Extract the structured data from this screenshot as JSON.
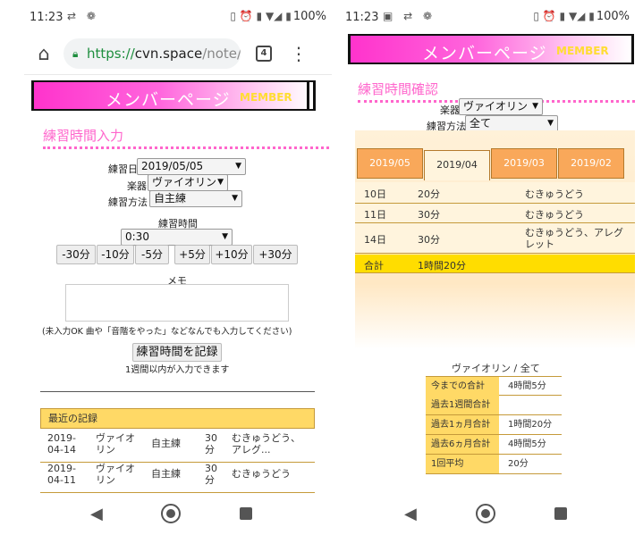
{
  "status": {
    "left": {
      "time": "11:23",
      "battery": "100%"
    },
    "right": {
      "time": "11:23",
      "battery": "100%"
    }
  },
  "browser": {
    "url_scheme": "https://",
    "url_host": "cvn.space",
    "url_path": "/note/",
    "tab_count": "4"
  },
  "banner": {
    "title": "メンバーページ",
    "subtitle": "MEMBER"
  },
  "input_page": {
    "section_title": "練習時間入力",
    "date_label": "練習日",
    "date_value": "2019/05/05",
    "instrument_label": "楽器",
    "instrument_value": "ヴァイオリン",
    "method_label": "練習方法",
    "method_value": "自主練",
    "duration_label": "練習時間",
    "duration_value": "0:30",
    "adjust_buttons": [
      "-30分",
      "-10分",
      "-5分",
      "+5分",
      "+10分",
      "+30分"
    ],
    "memo_label": "メモ",
    "memo_hint": "(未入力OK 曲や「音階をやった」などなんでも入力してください)",
    "submit_label": "練習時間を記録",
    "submit_note": "1週間以内が入力できます",
    "recent_title": "最近の記録",
    "recent_rows": [
      {
        "date_y": "2019-",
        "date_md": "04-14",
        "inst_a": "ヴァイオ",
        "inst_b": "リン",
        "method": "自主練",
        "mins_a": "30",
        "mins_b": "分",
        "memo_a": "むきゅうどう、",
        "memo_b": "アレグ..."
      },
      {
        "date_y": "2019-",
        "date_md": "04-11",
        "inst_a": "ヴァイオ",
        "inst_b": "リン",
        "method": "自主練",
        "mins_a": "30",
        "mins_b": "分",
        "memo_a": "むきゅうどう",
        "memo_b": ""
      }
    ]
  },
  "confirm_page": {
    "section_title": "練習時間確認",
    "instrument_label": "楽器",
    "instrument_value": "ヴァイオリン",
    "method_label": "練習方法",
    "method_value": "全て",
    "month_tabs": [
      "2019/05",
      "2019/04",
      "2019/03",
      "2019/02"
    ],
    "active_month": "2019/04",
    "rows": [
      {
        "day": "10日",
        "time": "20分",
        "memo_a": "むきゅうどう",
        "memo_b": ""
      },
      {
        "day": "11日",
        "time": "30分",
        "memo_a": "むきゅうどう",
        "memo_b": ""
      },
      {
        "day": "14日",
        "time": "30分",
        "memo_a": "むきゅうどう、アレグ",
        "memo_b": "レット"
      }
    ],
    "total_label": "合計",
    "total_value": "1時間20分",
    "summary_title": "ヴァイオリン / 全て",
    "summary": [
      {
        "label": "今までの合計",
        "value": "4時間5分"
      },
      {
        "label": "過去1週間合計",
        "value": ""
      },
      {
        "label": "過去1ヵ月合計",
        "value": "1時間20分"
      },
      {
        "label": "過去6ヵ月合計",
        "value": "4時間5分"
      },
      {
        "label": "1回平均",
        "value": "20分"
      }
    ]
  },
  "colors": {
    "accent_pink": "#ff66cc",
    "banner_pink": "#ff33cc",
    "gold": "#ffd966",
    "orange_tab": "#f9a85a",
    "total_yellow": "#ffdd00"
  },
  "icons": [
    "home-icon",
    "lock-icon",
    "tabs-icon",
    "more-menu-icon",
    "back-icon",
    "home-nav-icon",
    "recents-icon"
  ]
}
